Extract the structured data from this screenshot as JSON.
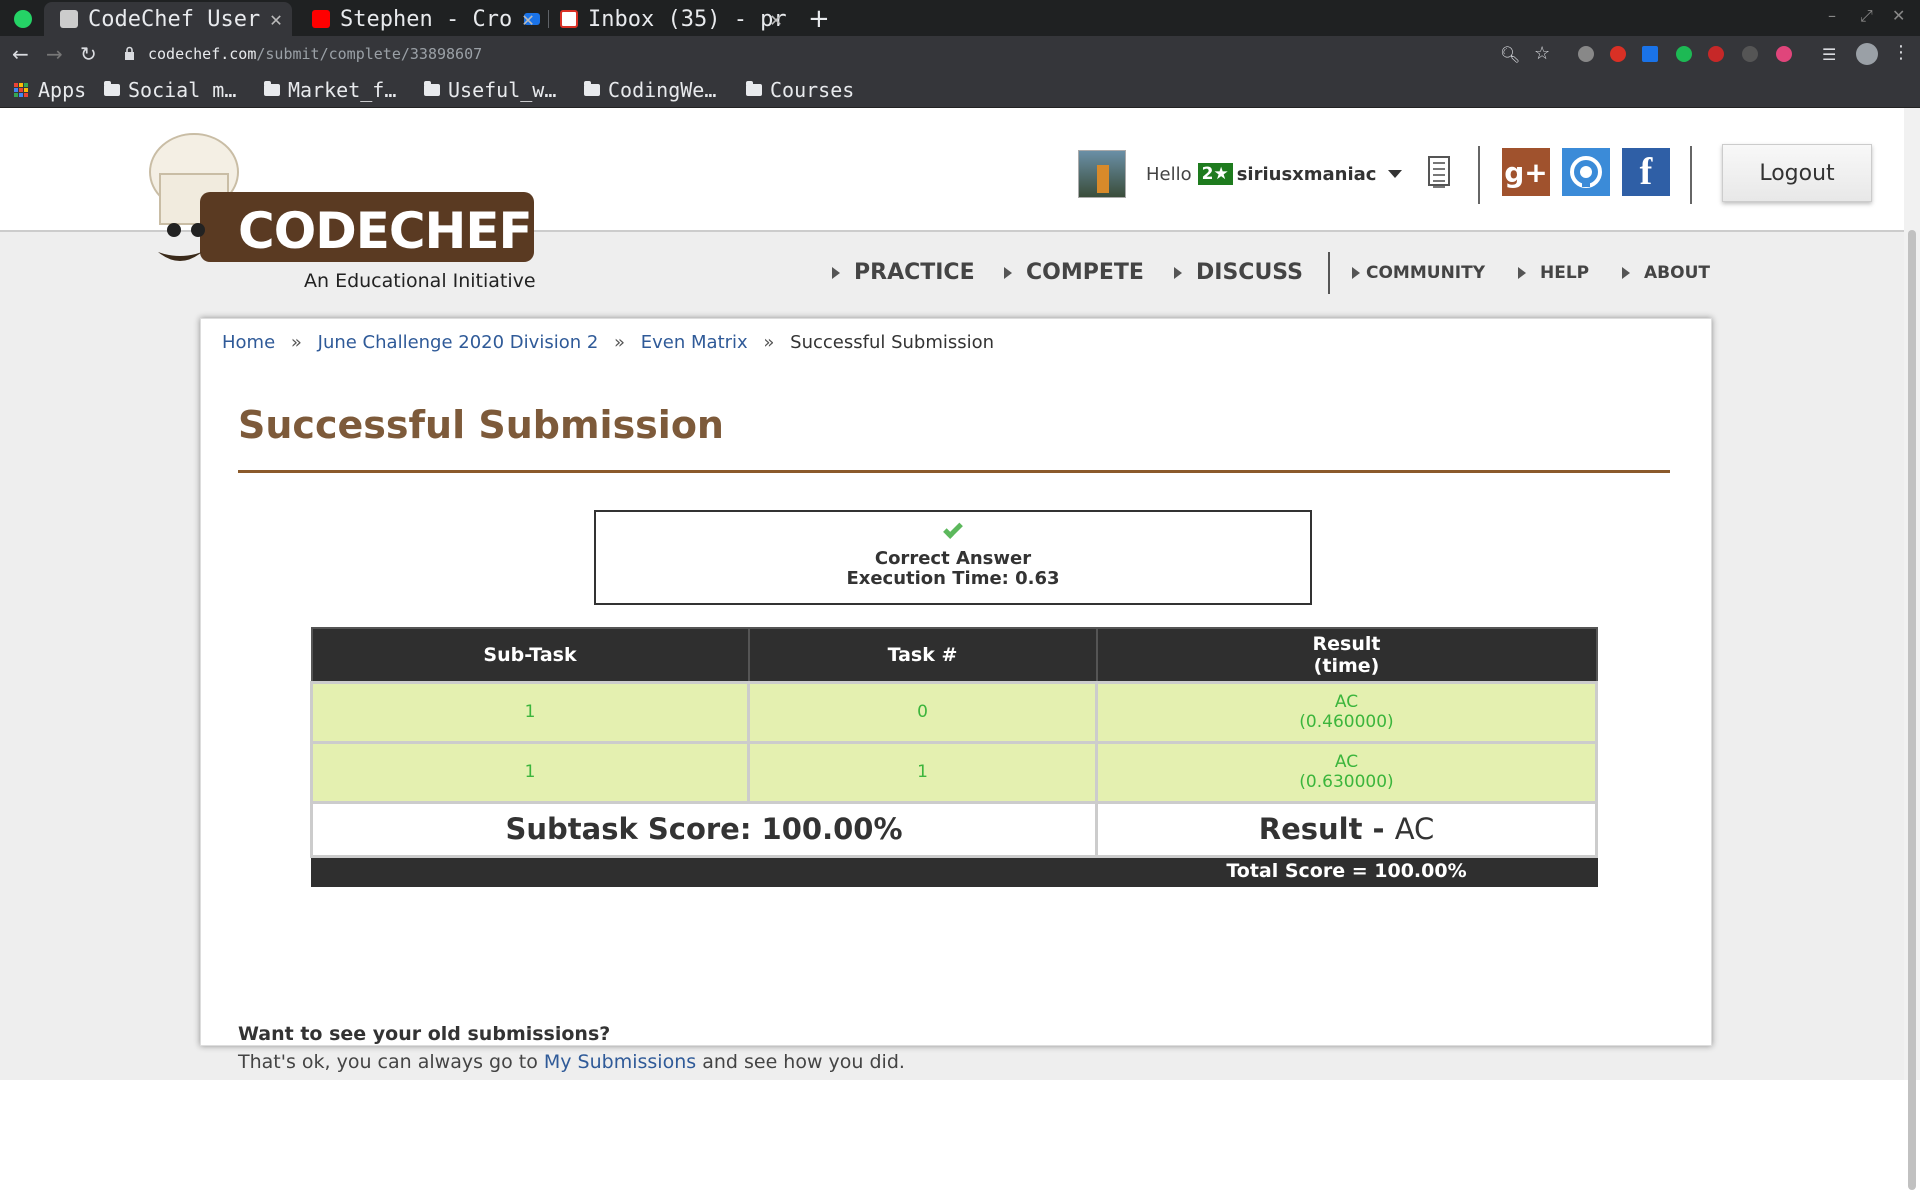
{
  "browser": {
    "tabs": [
      {
        "title": "CodeChef User"
      },
      {
        "title": "Stephen - Cro"
      },
      {
        "title": "Inbox (35) - pr"
      }
    ],
    "new_tab": "+",
    "url_host": "codechef.com",
    "url_path": "/submit/complete/33898607",
    "bookmarks": [
      "Apps",
      "Social m…",
      "Market_f…",
      "Useful_w…",
      "CodingWe…",
      "Courses"
    ]
  },
  "header": {
    "logo_text": "CODECHEF",
    "logo_tagline": "An Educational Initiative",
    "hello": "Hello",
    "stars": "2★",
    "username": "siriusxmaniac",
    "logout_label": "Logout"
  },
  "nav": {
    "main": [
      "PRACTICE",
      "COMPETE",
      "DISCUSS"
    ],
    "secondary": [
      "COMMUNITY",
      "HELP",
      "ABOUT"
    ]
  },
  "breadcrumb": {
    "items": [
      "Home",
      "June Challenge 2020 Division 2",
      "Even Matrix"
    ],
    "current": "Successful Submission",
    "separator": "»"
  },
  "page_title": "Successful Submission",
  "status": {
    "verdict": "Correct Answer",
    "execution_time": "Execution Time: 0.63"
  },
  "results_table": {
    "headers": [
      "Sub-Task",
      "Task #",
      "Result\n(time)"
    ],
    "header_result_line1": "Result",
    "header_result_line2": "(time)",
    "rows": [
      {
        "subtask": "1",
        "task": "0",
        "result": "AC",
        "time": "(0.460000)"
      },
      {
        "subtask": "1",
        "task": "1",
        "result": "AC",
        "time": "(0.630000)"
      }
    ],
    "subtask_score": "Subtask Score: 100.00%",
    "result_label": "Result -",
    "result_value": "AC",
    "total_score": "Total Score = 100.00%"
  },
  "old_submissions": {
    "question": "Want to see your old submissions?",
    "text_before": "That's ok, you can always go to",
    "link": "My Submissions",
    "text_after": "and see how you did."
  },
  "colors": {
    "title_brown": "#7d5a3a",
    "link_blue": "#2f5a98",
    "ac_green": "#3cb53c",
    "row_bg": "#e4f0b0",
    "table_header": "#2f2f2f"
  }
}
